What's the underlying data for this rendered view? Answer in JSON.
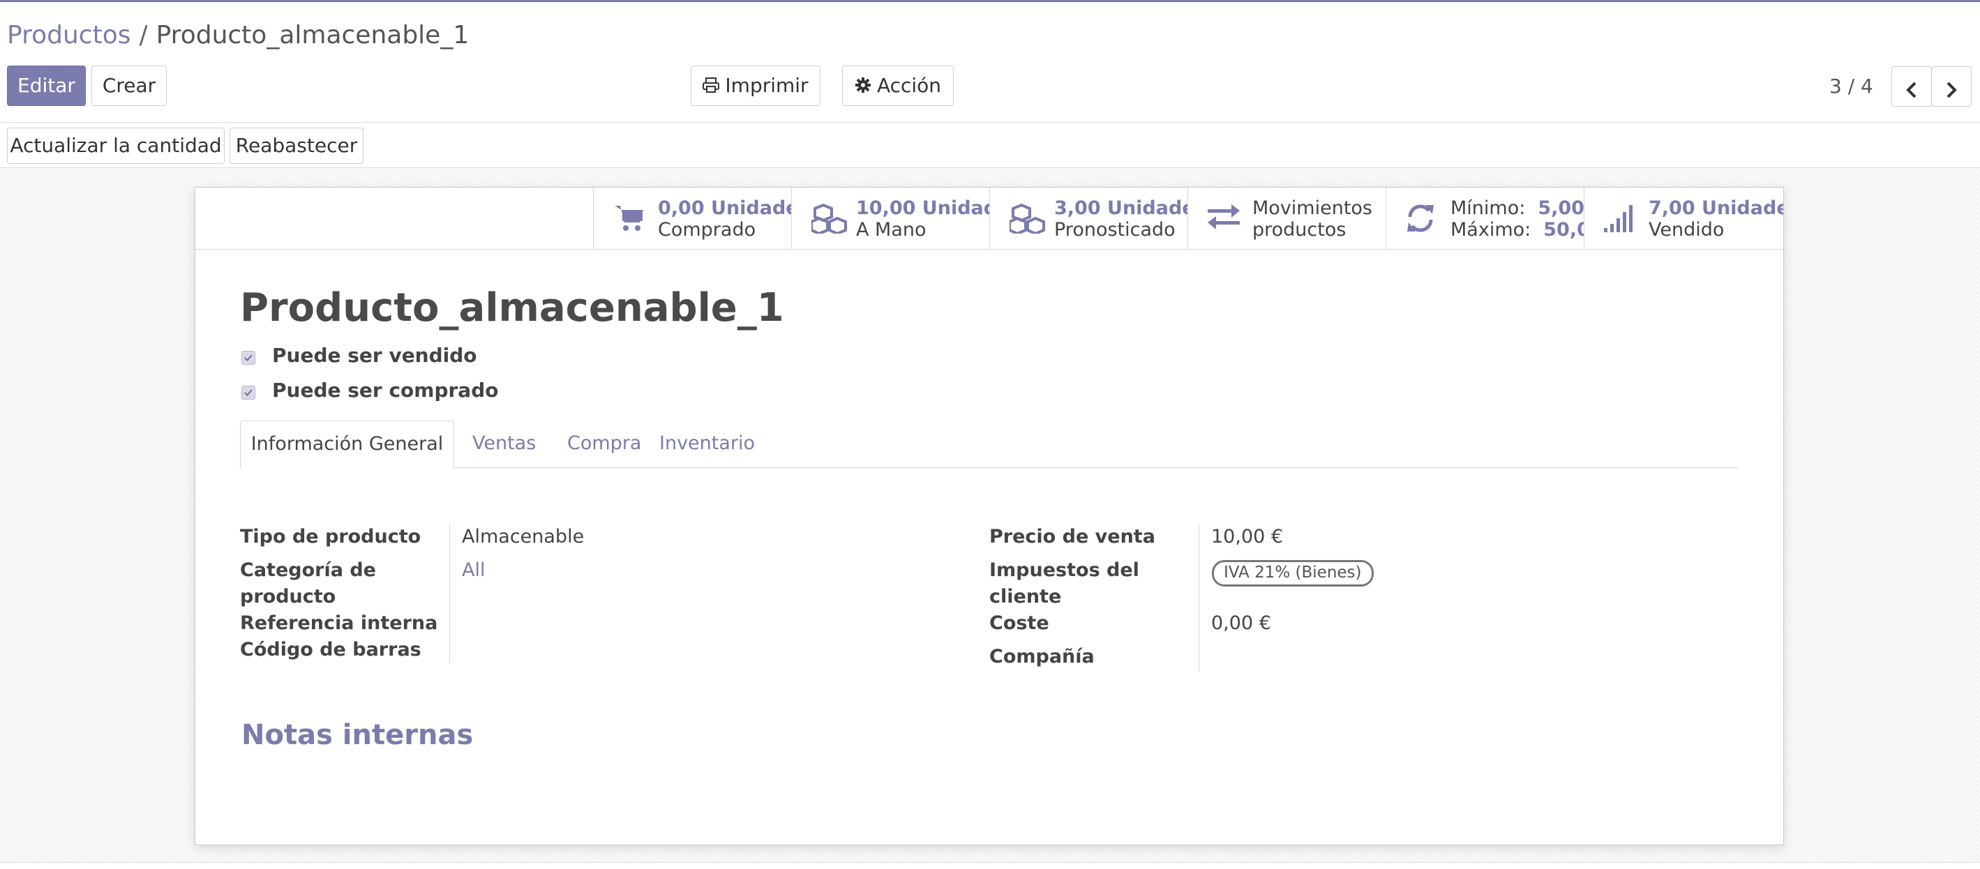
{
  "breadcrumb": {
    "parent": "Productos",
    "separator": "/",
    "current": "Producto_almacenable_1"
  },
  "toolbar": {
    "edit_label": "Editar",
    "create_label": "Crear",
    "print_label": "Imprimir",
    "action_label": "Acción"
  },
  "pager": {
    "value": "3 / 4"
  },
  "status_buttons": {
    "update_qty": "Actualizar la cantidad",
    "replenish": "Reabastecer"
  },
  "smart_buttons": {
    "purchased": {
      "value": "0,00 Unidade",
      "label": "Comprado",
      "icon": "cart-icon"
    },
    "on_hand": {
      "value": "10,00 Unidad",
      "label": "A Mano",
      "icon": "cubes-icon"
    },
    "forecasted": {
      "value": "3,00 Unidade",
      "label": "Pronosticado",
      "icon": "cubes-icon"
    },
    "moves": {
      "line1": "Movimientos",
      "line2": "productos",
      "icon": "exchange-icon"
    },
    "minmax": {
      "min_label": "Mínimo:",
      "min_value": "5,00",
      "max_label": "Máximo:",
      "max_value": "50,0",
      "icon": "refresh-icon"
    },
    "sold": {
      "value": "7,00 Unidade",
      "label": "Vendido",
      "icon": "signal-icon"
    }
  },
  "product": {
    "name": "Producto_almacenable_1",
    "can_be_sold_label": "Puede ser vendido",
    "can_be_purchased_label": "Puede ser comprado"
  },
  "tabs": [
    "Información General",
    "Ventas",
    "Compra",
    "Inventario"
  ],
  "general": {
    "type_label": "Tipo de producto",
    "type_value": "Almacenable",
    "category_label_1": "Categoría de",
    "category_label_2": "producto",
    "category_value": "All",
    "ref_label": "Referencia interna",
    "barcode_label": "Código de barras",
    "price_label": "Precio de venta",
    "price_value": "10,00 €",
    "taxes_label_1": "Impuestos del",
    "taxes_label_2": "cliente",
    "taxes_tag": "IVA 21% (Bienes)",
    "cost_label": "Coste",
    "cost_value": "0,00 €",
    "company_label": "Compañía"
  },
  "notes": {
    "title": "Notas internas"
  },
  "colors": {
    "accent": "#7c7bad"
  }
}
